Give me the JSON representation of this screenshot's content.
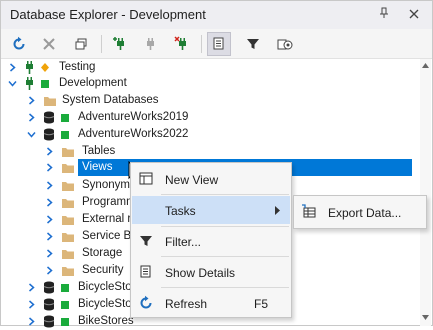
{
  "window": {
    "title": "Database Explorer - Development",
    "pin_icon": "pin-icon",
    "close_icon": "close-icon"
  },
  "toolbar": {
    "buttons": [
      {
        "name": "refresh-button",
        "icon": "refresh-icon"
      },
      {
        "name": "disconnect-button",
        "icon": "disconnect-icon"
      },
      {
        "name": "duplicate-connection-button",
        "icon": "duplicate-icon"
      },
      {
        "name": "new-connection-button",
        "icon": "new-connection-icon"
      },
      {
        "name": "edit-connection-button",
        "icon": "edit-connection-icon"
      },
      {
        "name": "delete-connection-button",
        "icon": "delete-connection-icon"
      },
      {
        "name": "show-details-button",
        "icon": "details-icon"
      },
      {
        "name": "filter-button",
        "icon": "filter-icon"
      },
      {
        "name": "connection-properties-button",
        "icon": "properties-icon"
      }
    ]
  },
  "tree": {
    "rows": [
      {
        "label": "Testing",
        "status_color": "#f0a30a"
      },
      {
        "label": "Development",
        "status_color": "#1aab3c"
      },
      {
        "label": "System Databases"
      },
      {
        "label": "AdventureWorks2019",
        "status_color": "#1aab3c"
      },
      {
        "label": "AdventureWorks2022",
        "status_color": "#1aab3c"
      },
      {
        "label": "Tables"
      },
      {
        "label": "Views"
      },
      {
        "label": "Synonyms"
      },
      {
        "label": "Programm"
      },
      {
        "label": "External r"
      },
      {
        "label": "Service Br"
      },
      {
        "label": "Storage"
      },
      {
        "label": "Security"
      },
      {
        "label": "BicycleStor",
        "status_color": "#1aab3c"
      },
      {
        "label": "BicycleStor",
        "status_color": "#1aab3c"
      },
      {
        "label": "BikeStores",
        "status_color": "#1aab3c"
      }
    ]
  },
  "context_menu": {
    "new_view": "New View",
    "tasks": "Tasks",
    "filter": "Filter...",
    "show_details": "Show Details",
    "refresh": "Refresh",
    "refresh_shortcut": "F5"
  },
  "submenu": {
    "export_data": "Export Data..."
  },
  "colors": {
    "selection": "#0078d7",
    "menu_highlight": "#cde0f7",
    "connected": "#1aab3c",
    "warning": "#f0a30a",
    "folder": "#dcb67a",
    "refresh_blue": "#1f6fbf"
  }
}
